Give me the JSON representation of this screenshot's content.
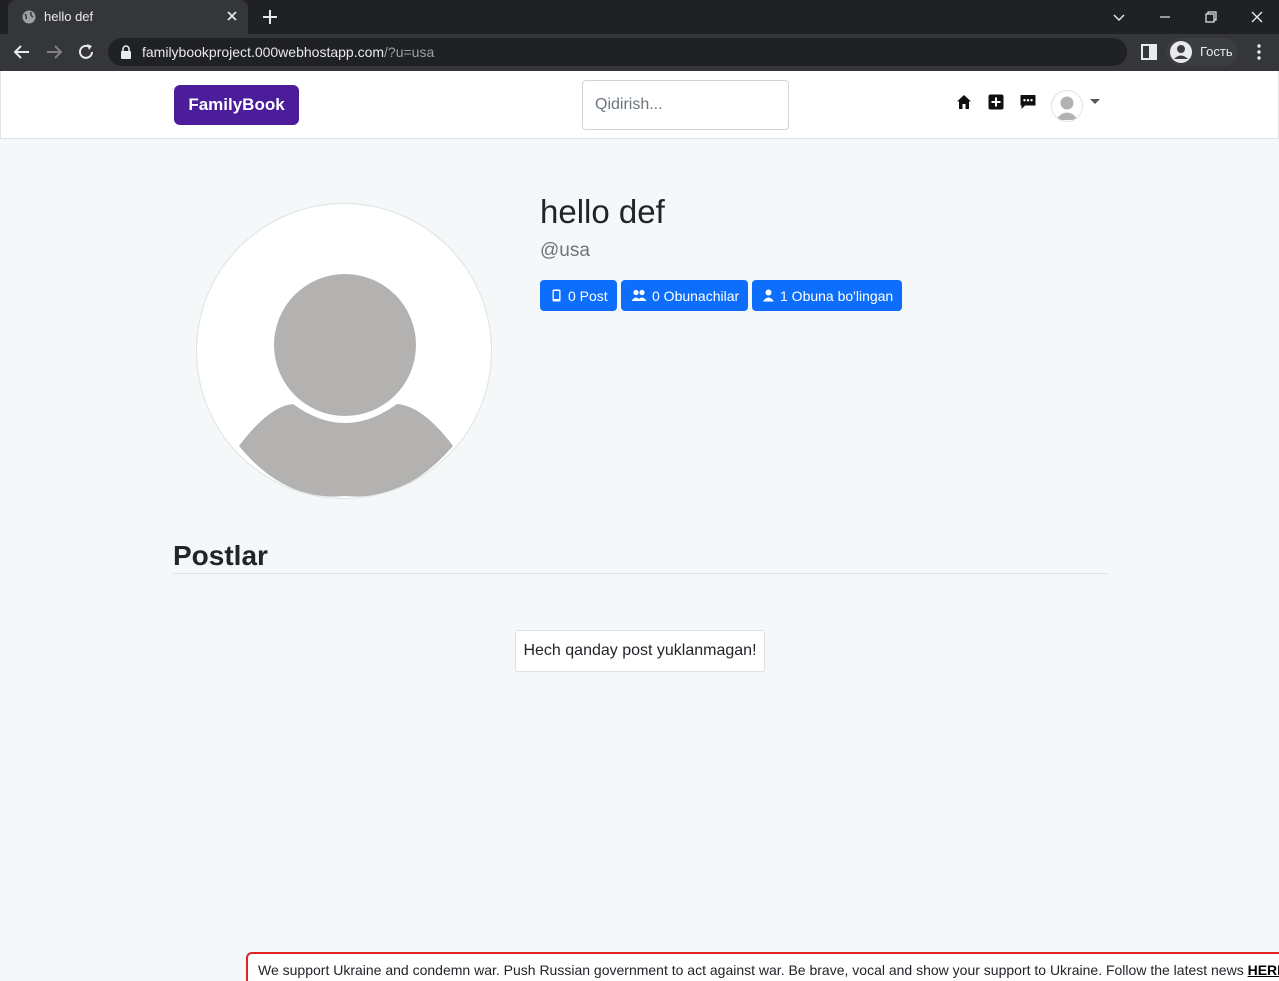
{
  "browser": {
    "tab_title": "hello def",
    "url_host": "familybookproject.000webhostapp.com",
    "url_path": "/?u=usa",
    "profile_label": "Гость"
  },
  "navbar": {
    "brand": "FamilyBook",
    "search_placeholder": "Qidirish..."
  },
  "profile": {
    "name": "hello def",
    "handle": "@usa",
    "stats": [
      {
        "label": "0 Post",
        "icon": "mobile-icon"
      },
      {
        "label": "0 Obunachilar",
        "icon": "users-icon"
      },
      {
        "label": "1 Obuna bo'lingan",
        "icon": "user-icon"
      }
    ]
  },
  "posts": {
    "title": "Postlar",
    "empty_message": "Hech qanday post yuklanmagan!"
  },
  "banner": {
    "text": "We support Ukraine and condemn war. Push Russian government to act against war. Be brave, vocal and show your support to Ukraine. Follow the latest news",
    "link": "HERE"
  },
  "colors": {
    "brand": "#4c1d9b",
    "primary": "#0d6efd",
    "banner_border": "#e02424"
  }
}
